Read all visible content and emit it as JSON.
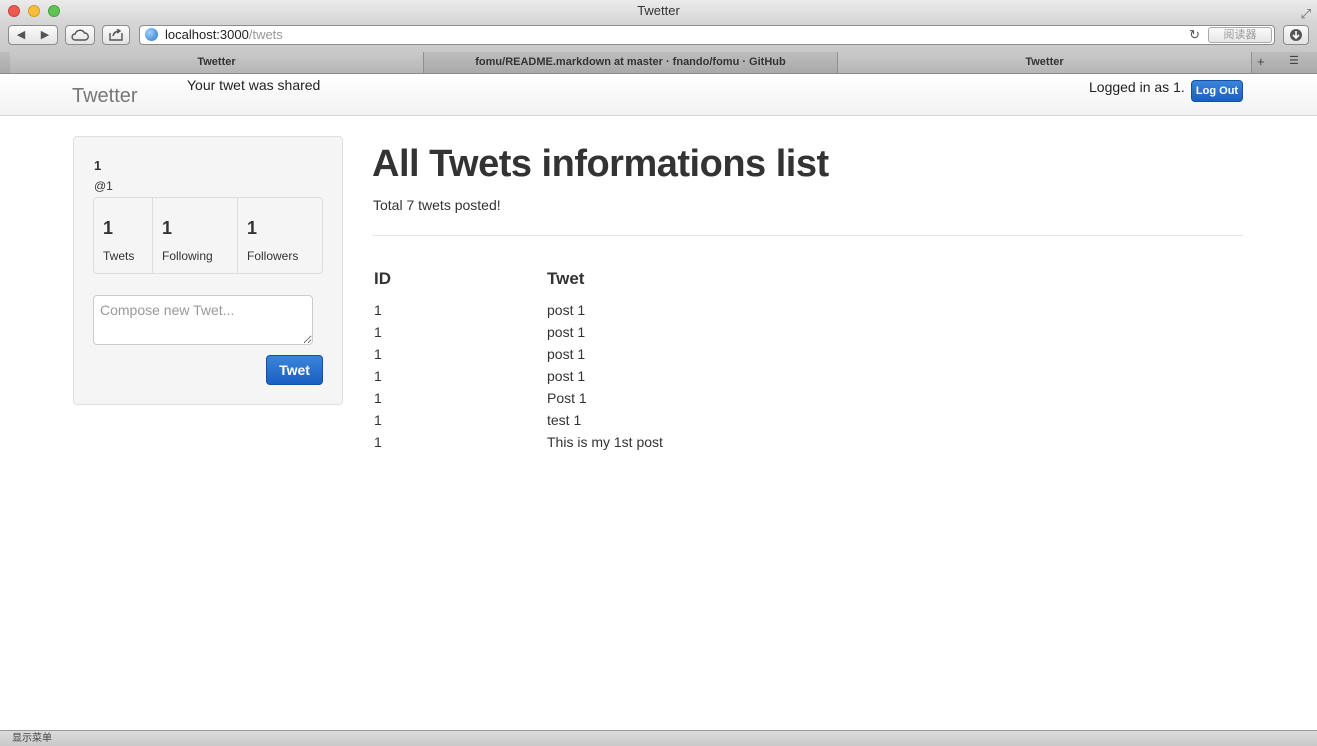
{
  "window": {
    "title": "Twetter"
  },
  "toolbar": {
    "back_icon": "◀",
    "forward_icon": "▶",
    "url_host": "localhost:3000",
    "url_path": "/twets",
    "reader_label": "阅读器"
  },
  "tabs": [
    {
      "label": "Twetter"
    },
    {
      "label": "fomu/README.markdown at master · fnando/fomu · GitHub"
    },
    {
      "label": "Twetter"
    }
  ],
  "navbar": {
    "brand": "Twetter",
    "flash": "Your twet was shared",
    "logged_in": "Logged in as 1.",
    "logout_label": "Log Out"
  },
  "profile": {
    "name": "1",
    "handle": "@1",
    "stats": [
      {
        "value": "1",
        "label": "Twets"
      },
      {
        "value": "1",
        "label": "Following"
      },
      {
        "value": "1",
        "label": "Followers"
      }
    ],
    "compose_placeholder": "Compose new Twet...",
    "tweet_button": "Twet"
  },
  "main": {
    "title": "All Twets informations list",
    "total": "Total 7 twets posted!",
    "columns": [
      "ID",
      "Twet"
    ],
    "rows": [
      {
        "id": "1",
        "twet": "post 1"
      },
      {
        "id": "1",
        "twet": "post 1"
      },
      {
        "id": "1",
        "twet": "post 1"
      },
      {
        "id": "1",
        "twet": "post 1"
      },
      {
        "id": "1",
        "twet": "Post 1"
      },
      {
        "id": "1",
        "twet": "test 1"
      },
      {
        "id": "1",
        "twet": "This is my 1st post"
      }
    ]
  },
  "statusbar": {
    "label": "显示菜单"
  }
}
